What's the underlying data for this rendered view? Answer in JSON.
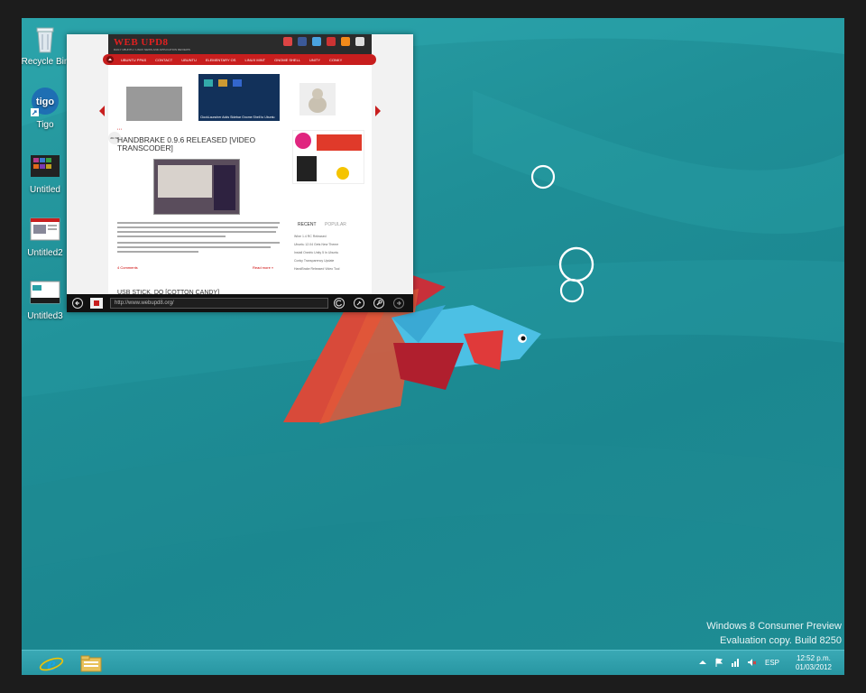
{
  "desktop": {
    "icons": [
      {
        "label": "Recycle Bin",
        "icon": "recycle-bin-icon"
      },
      {
        "label": "Tigo",
        "icon": "tigo-icon"
      },
      {
        "label": "Untitled",
        "icon": "image-file-icon"
      },
      {
        "label": "Untitled2",
        "icon": "image-file-icon"
      },
      {
        "label": "Untitled3",
        "icon": "image-file-icon"
      }
    ]
  },
  "browser": {
    "address": "http://www.webupd8.org/",
    "site": {
      "logo": "WEB UPD8",
      "tagline": "DAILY UBUNTU / LINUX NEWS AND APPLICATION REVIEWS",
      "nav": [
        "UBUNTU PPAS",
        "CONTACT",
        "UBUNTU",
        "ELEMENTARY OS",
        "LINUX MINT",
        "GNOME SHELL",
        "UNITY",
        "CONKY"
      ],
      "slide_caption": "ClockLauncher Adds Sidebar Gnome Shell to Ubuntu",
      "post_date": "20 / 02",
      "post_title": "HANDBRAKE 0.9.6 RELEASED [VIDEO TRANSCODER]",
      "read_more": "Read more »",
      "comments": "4 Comments",
      "next_post_title": "USB STICK, DO [COTTON CANDY]",
      "sidebar_tabs": {
        "recent": "RECENT",
        "popular": "POPULAR"
      },
      "recent_posts": [
        "Wine 1.4 RC Released",
        "Ubuntu 12.04 Gets New Theme",
        "Install Oneiric Unity 5 In Ubuntu",
        "Conky Transparency Update",
        "HandBrake Released Video Tool"
      ]
    }
  },
  "watermark": {
    "line1": "Windows 8 Consumer Preview",
    "line2": "Evaluation copy. Build 8250"
  },
  "taskbar": {
    "pinned": [
      {
        "icon": "internet-explorer-icon"
      },
      {
        "icon": "file-explorer-icon"
      }
    ],
    "language": "ESP",
    "time": "12:52 p.m.",
    "date": "01/03/2012"
  },
  "colors": {
    "desktop": "#1f8f97",
    "taskbar": "#2796a2",
    "site_red": "#c81e1e",
    "fish_blue": "#4cc0e4",
    "fish_red": "#d23a3a"
  }
}
